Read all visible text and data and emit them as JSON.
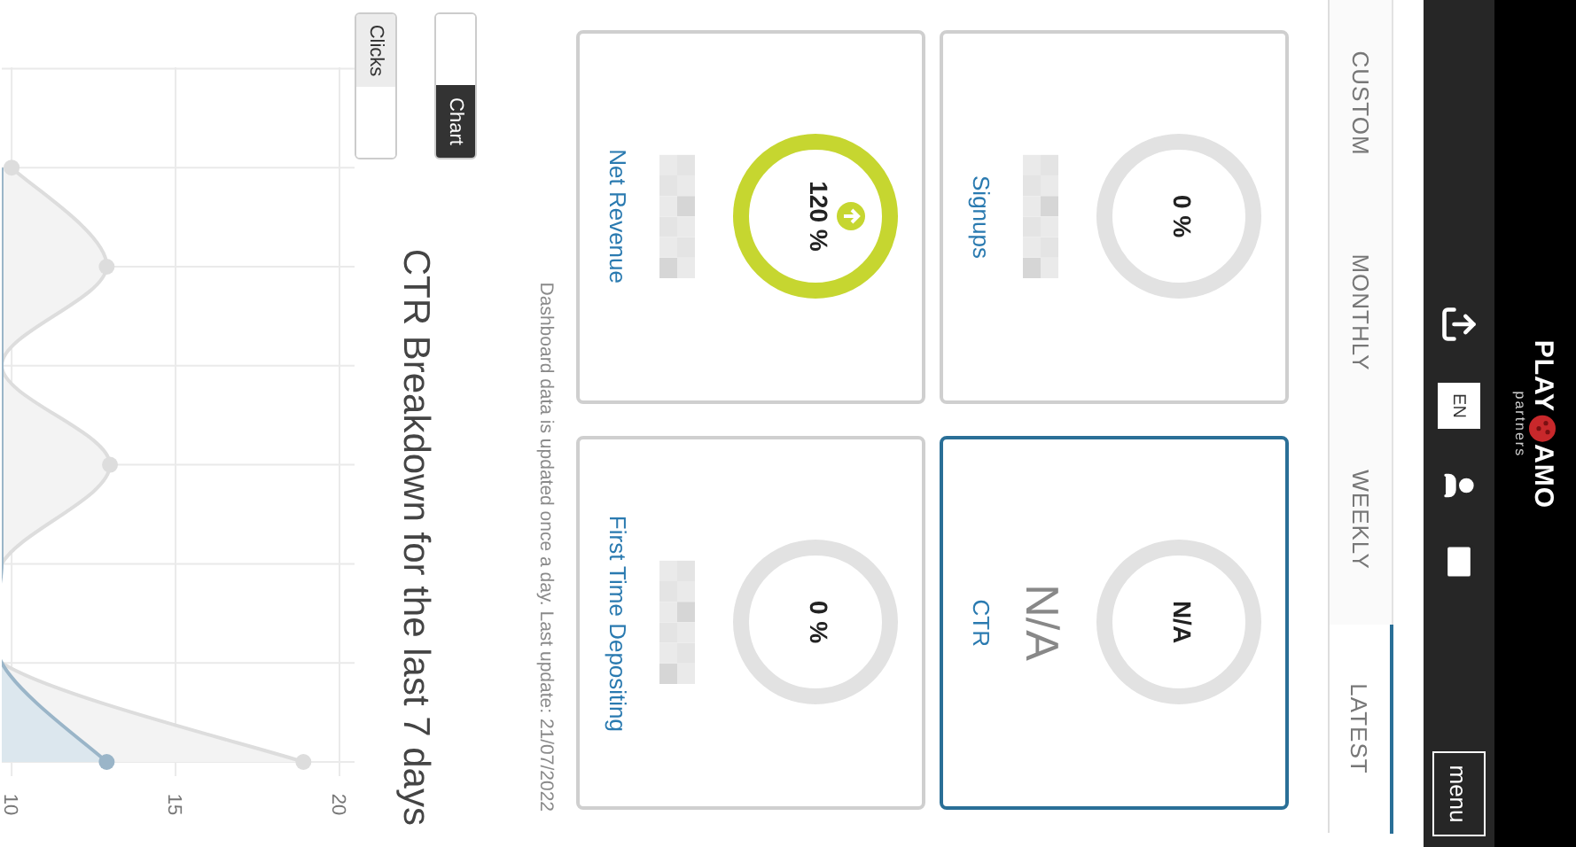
{
  "header": {
    "menu_label": "menu",
    "logo": {
      "left": "PLAY",
      "right": "AMO",
      "sub": "partners"
    },
    "language": "EN"
  },
  "tabs": [
    {
      "label": "LATEST",
      "selected": true
    },
    {
      "label": "WEEKLY",
      "selected": false
    },
    {
      "label": "MONTHLY",
      "selected": false
    },
    {
      "label": "CUSTOM",
      "selected": false
    }
  ],
  "cards": [
    {
      "ring_value": "N/A",
      "value": "N/A",
      "label": "CTR",
      "selected": true,
      "trend_up": false
    },
    {
      "ring_value": "0 %",
      "label": "Signups",
      "selected": false,
      "trend_up": false
    },
    {
      "ring_value": "0 %",
      "label": "First Time Depositing",
      "selected": false,
      "trend_up": false
    },
    {
      "ring_value": "120 %",
      "label": "Net Revenue",
      "selected": false,
      "trend_up": true
    }
  ],
  "footnote": "Dashboard data is updated once a day. Last update: 21/07/2022",
  "breakdown": {
    "title": "CTR Breakdown for the last 7 days",
    "toggles": [
      {
        "label": "Chart"
      },
      {
        "label": "Clicks"
      }
    ],
    "axis_labels": [
      "20",
      "15",
      "10"
    ]
  }
}
